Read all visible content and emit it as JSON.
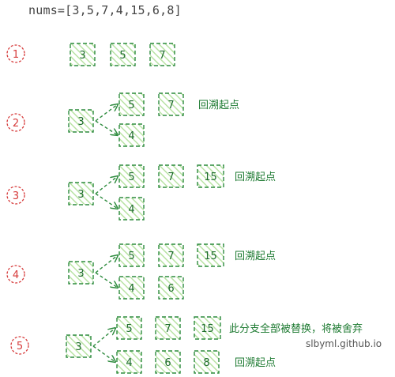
{
  "header": "nums=[3,5,7,4,15,6,8]",
  "colors": {
    "box_stroke": "#2e8b3e",
    "box_hatch": "#b9e3a4",
    "box_text": "#1d6b2c",
    "arrow": "#2e8b3e",
    "step_circle": "#d63a3a",
    "annotation": "#1d7a31",
    "watermark": "#555555"
  },
  "steps": [
    {
      "label": "1",
      "root": null,
      "upper": [
        "3",
        "5",
        "7"
      ],
      "lower": [],
      "upper_note": "",
      "lower_note": ""
    },
    {
      "label": "2",
      "root": "3",
      "upper": [
        "5",
        "7"
      ],
      "lower": [
        "4"
      ],
      "upper_note": "回溯起点",
      "lower_note": ""
    },
    {
      "label": "3",
      "root": "3",
      "upper": [
        "5",
        "7",
        "15"
      ],
      "lower": [
        "4"
      ],
      "upper_note": "回溯起点",
      "lower_note": ""
    },
    {
      "label": "4",
      "root": "3",
      "upper": [
        "5",
        "7",
        "15"
      ],
      "lower": [
        "4",
        "6"
      ],
      "upper_note": "回溯起点",
      "lower_note": ""
    },
    {
      "label": "5",
      "root": "3",
      "upper": [
        "5",
        "7",
        "15"
      ],
      "lower": [
        "4",
        "6",
        "8"
      ],
      "upper_note": "此分支全部被替换，将被舍弃",
      "lower_note": "回溯起点"
    }
  ],
  "watermark": "slbyml.github.io"
}
